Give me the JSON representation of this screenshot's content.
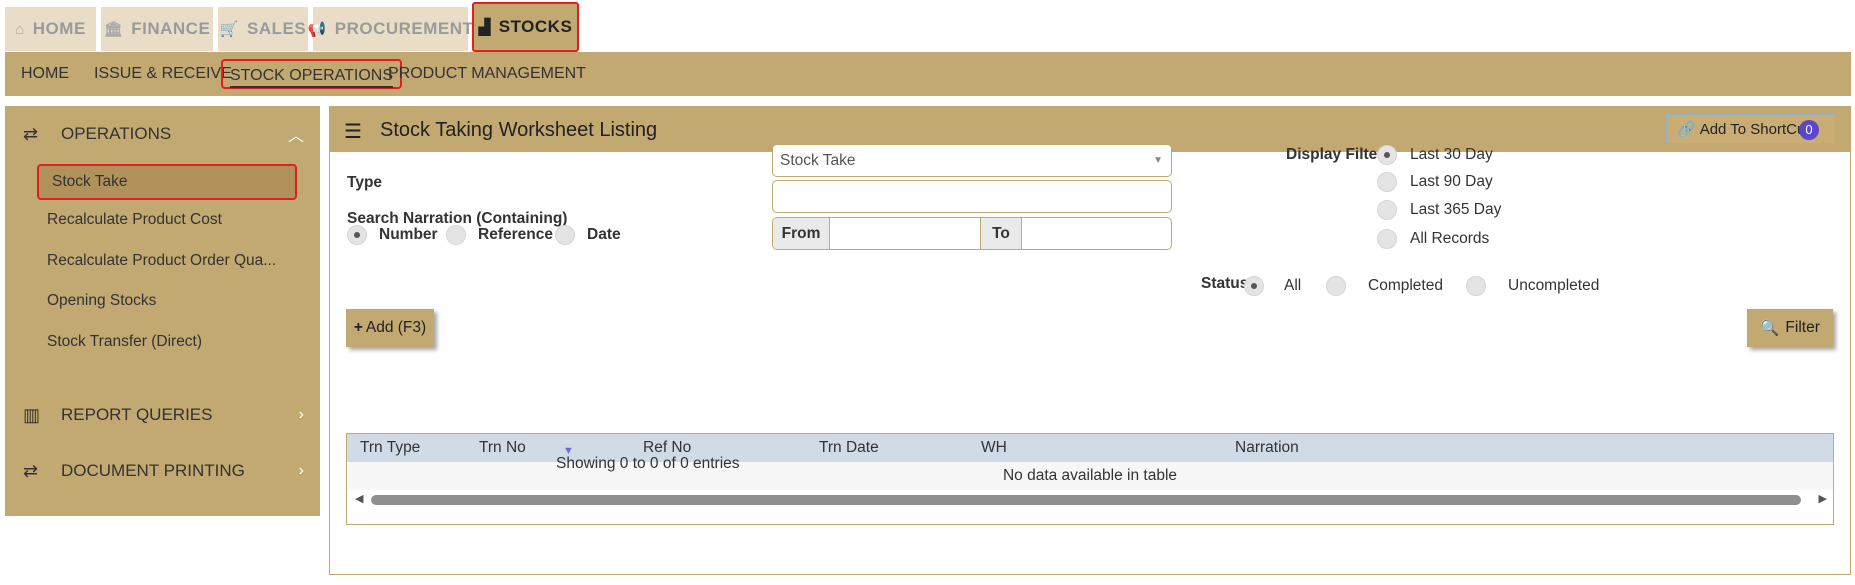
{
  "top_tabs": [
    {
      "label": "HOME",
      "icon": "home-icon",
      "glyph": "⌂"
    },
    {
      "label": "FINANCE",
      "icon": "bank-icon",
      "glyph": "🏛"
    },
    {
      "label": "SALES",
      "icon": "cart-icon",
      "glyph": "🛒"
    },
    {
      "label": "PROCUREMENT",
      "icon": "megaphone-icon",
      "glyph": "📢"
    },
    {
      "label": "STOCKS",
      "icon": "factory-icon",
      "glyph": "▟",
      "active": true
    }
  ],
  "sub_nav": [
    "HOME",
    "ISSUE & RECEIVE",
    "STOCK OPERATIONS",
    "PRODUCT MANAGEMENT"
  ],
  "sidebar": {
    "operations_label": "OPERATIONS",
    "items": [
      "Stock Take",
      "Recalculate Product Cost",
      "Recalculate Product Order Qua...",
      "Opening Stocks",
      "Stock Transfer (Direct)"
    ],
    "report_queries_label": "REPORT QUERIES",
    "document_printing_label": "DOCUMENT PRINTING"
  },
  "main": {
    "title": "Stock Taking Worksheet Listing",
    "shortcut_label": "Add To ShortCut",
    "shortcut_count": "0",
    "type_label": "Type",
    "type_value": "Stock Take",
    "search_label": "Search Narration (Containing)",
    "search_value": "",
    "sort_options": [
      "Number",
      "Reference",
      "Date"
    ],
    "from_label": "From",
    "to_label": "To",
    "display_filter_label": "Display Filter",
    "display_filter_options": [
      "Last 30 Day",
      "Last 90 Day",
      "Last 365 Day",
      "All Records"
    ],
    "status_label": "Status",
    "status_options": [
      "All",
      "Completed",
      "Uncompleted"
    ],
    "add_button": "Add (F3)",
    "filter_button": "Filter"
  },
  "table": {
    "columns": [
      "Trn Type",
      "Trn No",
      "Ref No",
      "Trn Date",
      "WH",
      "Narration"
    ],
    "empty_message": "No data available in table",
    "info": "Showing 0 to 0 of 0 entries"
  },
  "colors": {
    "accent": "#c2a871",
    "active_outline": "#e02020",
    "table_header": "#d0dbe6",
    "badge": "#5b48c8"
  }
}
